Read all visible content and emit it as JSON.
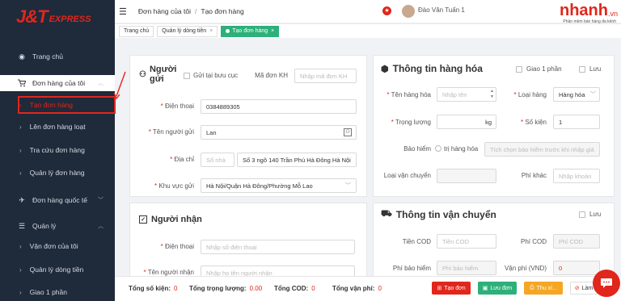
{
  "logo": {
    "brand": "J&T",
    "suffix": "EXPRESS"
  },
  "sidebar": {
    "items": [
      {
        "label": "Trang chủ"
      },
      {
        "label": "Đơn hàng của tôi"
      },
      {
        "label": "Tạo đơn hàng"
      },
      {
        "label": "Lên đơn hàng loạt"
      },
      {
        "label": "Tra cứu đơn hàng"
      },
      {
        "label": "Quản lý đơn hàng"
      },
      {
        "label": "Đơn hàng quốc tế"
      },
      {
        "label": "Quản lý"
      },
      {
        "label": "Vận đơn của tôi"
      },
      {
        "label": "Quản lý dòng tiền"
      },
      {
        "label": "Giao 1 phần"
      }
    ]
  },
  "header": {
    "breadcrumb": [
      "Đơn hàng của tôi",
      "Tạo đơn hàng"
    ],
    "username": "Đào Văn Tuấn 1",
    "brand_logo": "nhanh",
    "brand_suffix": ".vn",
    "brand_tagline": "Phần mềm bán hàng đa kênh"
  },
  "tabs": [
    {
      "label": "Trang chủ"
    },
    {
      "label": "Quản lý dòng tiền"
    },
    {
      "label": "Tạo đơn hàng"
    }
  ],
  "sender": {
    "title": "Người gửi",
    "post_office_label": "Gửi tại bưu cục",
    "order_code_label": "Mã đơn KH",
    "order_code_placeholder": "Nhập mã đơn KH",
    "phone_label": "Điện thoại",
    "phone_value": "0384889305",
    "name_label": "Tên người gửi",
    "name_value": "Lan",
    "address_label": "Địa chỉ",
    "house_placeholder": "Số nhà",
    "address_value": "Số 3 ngõ 140 Trần Phú Hà Đông Hà Nội",
    "area_label": "Khu vực gửi",
    "area_value": "Hà Nội/Quận Hà Đông/Phường Mỗ Lao"
  },
  "receiver": {
    "title": "Người nhận",
    "phone_label": "Điện thoại",
    "phone_placeholder": "Nhập số điện thoại",
    "name_label": "Tên người nhận",
    "name_placeholder": "Nhập họ tên người nhận"
  },
  "goods": {
    "title": "Thông tin hàng hóa",
    "partial_label": "Giao 1 phần",
    "save_label": "Lưu",
    "name_label": "Tên hàng hóa",
    "name_placeholder": "Nhập tên",
    "type_label": "Loại hàng",
    "type_value": "Hàng hóa",
    "weight_label": "Trọng lượng",
    "weight_unit": "kg",
    "qty_label": "Số kiện",
    "qty_value": "1",
    "insurance_label": "Bảo hiểm",
    "insurance_value_label": "trị hàng hóa",
    "insurance_placeholder": "Tích chọn bảo hiểm trước khi nhập giá",
    "ship_type_label": "Loại vận chuyển",
    "other_fee_label": "Phí khác",
    "other_fee_placeholder": "Nhập khoản"
  },
  "shipping": {
    "title": "Thông tin vận chuyển",
    "save_label": "Lưu",
    "cod_label": "Tiền COD",
    "cod_placeholder": "Tiền COD",
    "cod_fee_label": "Phí COD",
    "cod_fee_placeholder": "Phí COD",
    "ins_fee_label": "Phí bảo hiểm",
    "ins_fee_placeholder": "Phí bảo hiểm",
    "ship_fee_label": "Vận phí (VND)",
    "ship_fee_value": "0"
  },
  "footer": {
    "total_packages_label": "Tổng số kiện:",
    "total_packages": "0",
    "total_weight_label": "Tổng trọng lượng:",
    "total_weight": "0.00",
    "total_cod_label": "Tổng COD:",
    "total_cod": "0",
    "total_fee_label": "Tổng vận phí:",
    "total_fee": "0",
    "create_label": "Tạo đơn",
    "draft_label": "Lưu đơn",
    "print_label": "Thu xí...",
    "reset_label": "Làm"
  },
  "colors": {
    "brand": "#e1261c",
    "sidebar": "#1f2a3a",
    "tab_active": "#2db07a"
  }
}
